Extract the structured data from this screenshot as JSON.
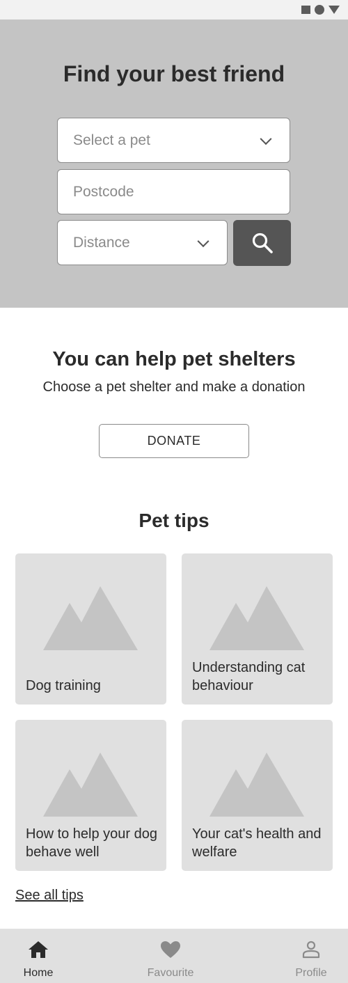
{
  "hero": {
    "title": "Find your best friend",
    "select_pet_placeholder": "Select a pet",
    "postcode_placeholder": "Postcode",
    "distance_placeholder": "Distance"
  },
  "help": {
    "title": "You can help pet shelters",
    "subtitle": "Choose a pet shelter and make a donation",
    "donate_label": "DONATE"
  },
  "tips": {
    "title": "Pet tips",
    "cards": [
      {
        "label": "Dog training"
      },
      {
        "label": "Understanding cat behaviour"
      },
      {
        "label": "How to help your dog behave well"
      },
      {
        "label": "Your cat's health and welfare"
      }
    ],
    "see_all_label": "See all tips"
  },
  "nav": {
    "items": [
      {
        "label": "Home",
        "icon": "home-icon",
        "active": true
      },
      {
        "label": "Favourite",
        "icon": "heart-icon",
        "active": false
      },
      {
        "label": "Profile",
        "icon": "person-icon",
        "active": false
      }
    ]
  },
  "colors": {
    "hero_bg": "#c4c4c4",
    "search_button": "#555555",
    "card_bg": "#e0e0e0",
    "nav_bg": "#e0e0e0"
  }
}
